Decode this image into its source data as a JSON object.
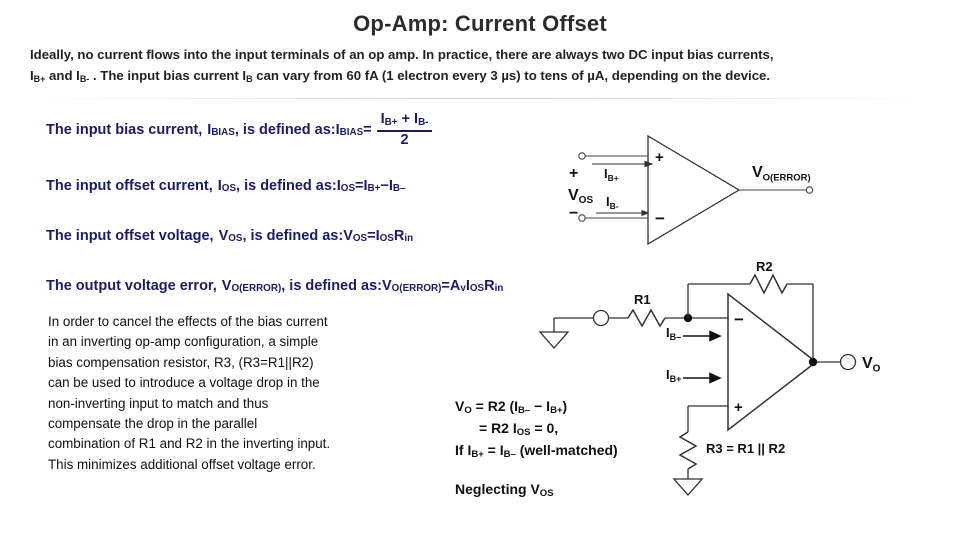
{
  "slide": {
    "title": "Op-Amp: Current Offset"
  },
  "intro": {
    "line1": "Ideally, no current flows into the input terminals of an op amp. In practice, there are always two DC input bias currents,",
    "line2_a": "I",
    "line2_b_sub": "B+",
    "line2_c": " and I",
    "line2_d_sub": "B-",
    "line2_e": " . The input bias current I",
    "line2_f_sub": "B",
    "line2_g": " can vary from 60 fA (1 electron every 3 µs) to tens of µA, depending on the device."
  },
  "definitions": [
    {
      "lead": "The input bias current, ",
      "sym": "I",
      "sym_sub": "BIAS",
      "mid": ", is defined as: ",
      "rhs_sym": "I",
      "rhs_sub": "BIAS",
      "eq": " = ",
      "numer": "Iʙ₊ + Iʙ₋",
      "num_a": "I",
      "num_a_sub": "B+",
      "num_plus": " + ",
      "num_b": "I",
      "num_b_sub": "B-",
      "denom": "2"
    },
    {
      "lead": "The input offset current, ",
      "sym": "I",
      "sym_sub": "OS",
      "mid": ", is defined as:  ",
      "rhs": "I",
      "rhs_sub": "OS",
      "eq": " = ",
      "t1": "I",
      "t1_sub": "B+",
      "minus": " −  ",
      "t2": "I",
      "t2_sub": "B–"
    },
    {
      "lead": "The input offset voltage, ",
      "sym": "V",
      "sym_sub": "OS",
      "mid": ", is defined as:  ",
      "rhs": "V",
      "rhs_sub": "OS",
      "eq": " = ",
      "t1": "I",
      "t1_sub": "OS",
      "t2": " R",
      "t2_sub": "in"
    },
    {
      "lead": "The output voltage error, ",
      "sym": "V",
      "sym_sub": "O(ERROR)",
      "mid": ", is defined as: ",
      "rhs": "V",
      "rhs_sub": "O(ERROR)",
      "eq": " = ",
      "t1": "A",
      "t1_sub": "v",
      "t2": " I",
      "t2_sub": "OS",
      "t3": " R",
      "t3_sub": "in"
    }
  ],
  "body_paragraph": {
    "lines": [
      "In order to cancel the effects of the bias current",
      "in an inverting op-amp configuration, a simple",
      "bias compensation resistor, R3, (R3=R1||R2)",
      "can be used to introduce a voltage drop in the",
      "non-inverting input to match and thus",
      "compensate the drop in the parallel",
      "combination of R1 and R2 in the inverting input.",
      "This minimizes additional offset voltage error."
    ]
  },
  "equations": {
    "e1_a": "V",
    "e1_a_sub": "O",
    "e1_b": " = R2 (I",
    "e1_b_sub": "B–",
    "e1_c": " − I",
    "e1_c_sub": "B+",
    "e1_d": ")",
    "e2_a": "= R2 I",
    "e2_a_sub": "OS",
    "e2_b": " = 0,",
    "e3_a": "If I",
    "e3_a_sub": "B+",
    "e3_b": " = I",
    "e3_b_sub": "B–",
    "e3_c": " (well-matched)",
    "e4_a": "Neglecting V",
    "e4_a_sub": "OS"
  },
  "diagram_top": {
    "name": "op-amp-error-model",
    "labels": {
      "plus_source": "+",
      "minus_source": "−",
      "vos": "V",
      "vos_sub": "OS",
      "ib_plus": "I",
      "ib_plus_sub": "B+",
      "ib_minus": "I",
      "ib_minus_sub": "B-",
      "opamp_plus": "+",
      "opamp_minus": "−",
      "output": "V",
      "output_sub": "O(ERROR)"
    }
  },
  "diagram_bottom": {
    "name": "inverting-amp-bias-compensation",
    "labels": {
      "r1": "R1",
      "r2": "R2",
      "r3": "R3 = R1 || R2",
      "ib_minus": "I",
      "ib_minus_sub": "B–",
      "ib_plus": "I",
      "ib_plus_sub": "B+",
      "opamp_minus": "−",
      "opamp_plus": "+",
      "vo": "V",
      "vo_sub": "O"
    }
  },
  "colors": {
    "navy": "#1b1b6b",
    "title": "#2b2b2b",
    "ink": "#111111",
    "background": "#ffffff"
  }
}
